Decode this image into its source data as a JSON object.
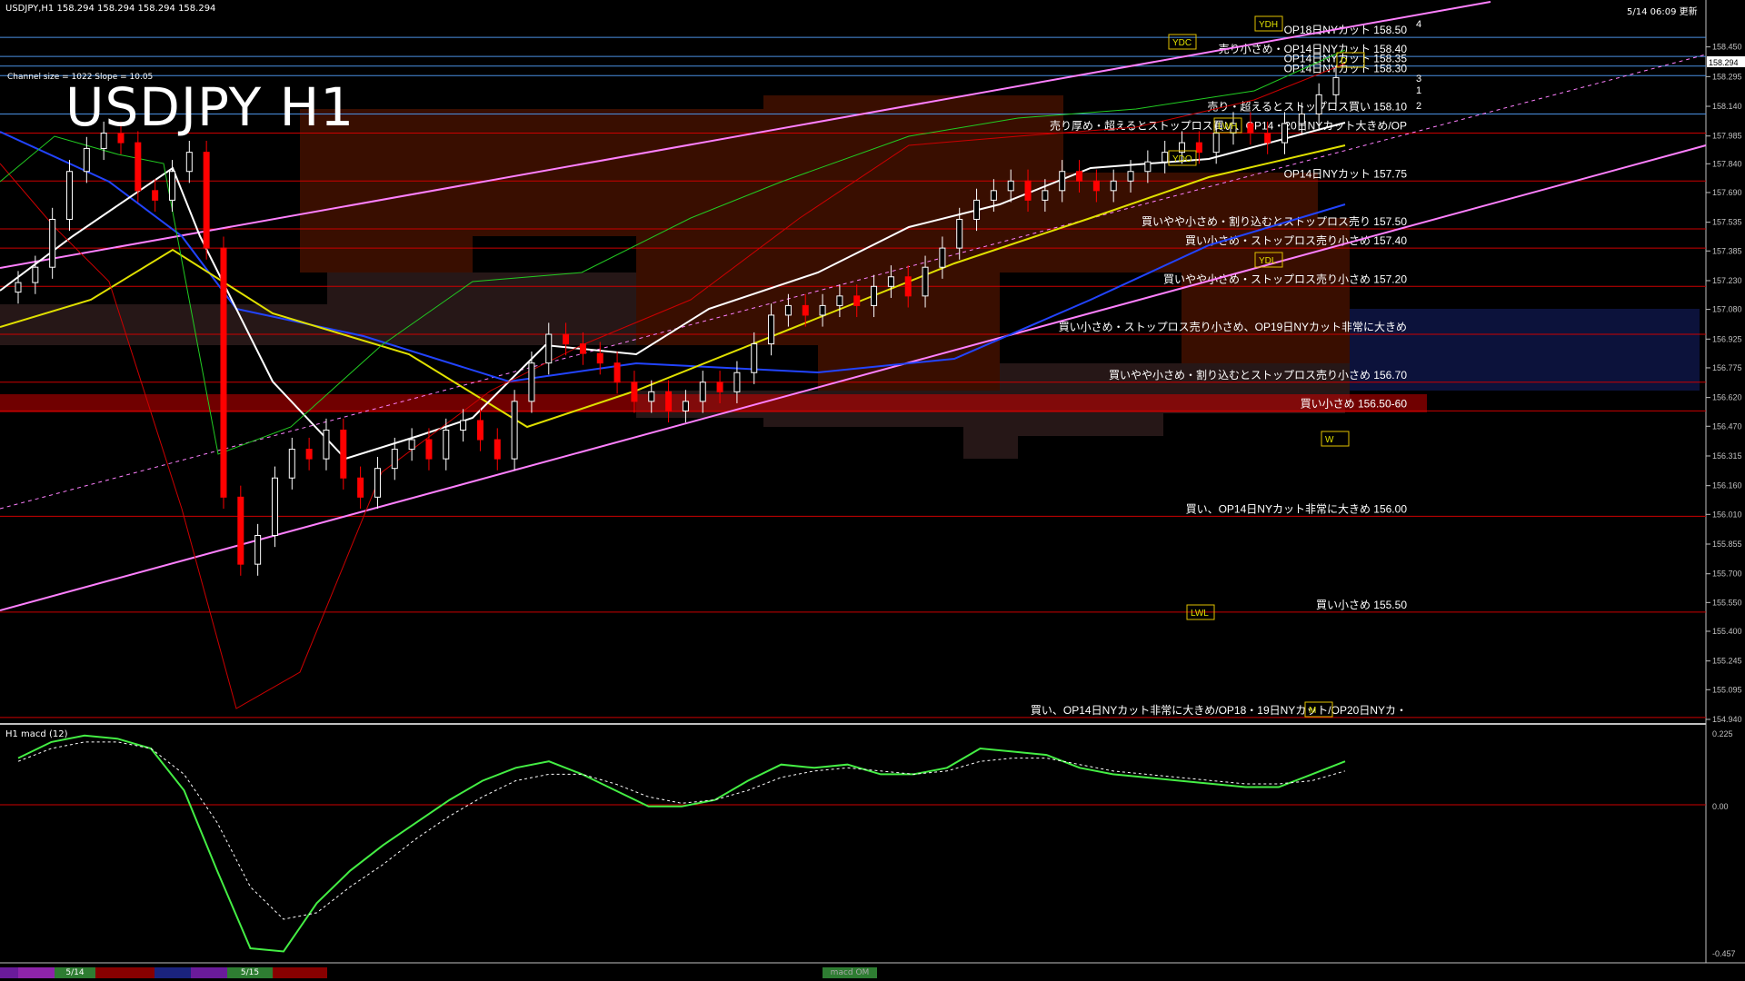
{
  "header": {
    "symbol_info": "USDJPY,H1  158.294 158.294 158.294 158.294",
    "title": "USDJPY H1",
    "channel_info": "Channel size = 1022  Slope = 10.05",
    "datetime": "5/14 06:09 更新",
    "price_box": "158.294"
  },
  "subwindow": {
    "label": "H1  macd (12)"
  },
  "tabs": [
    "",
    "5/14",
    "",
    "",
    "",
    "5/15",
    ""
  ],
  "tab_macd": "macd OM",
  "colors": {
    "background": "#000000",
    "up_candle": "#ffffff",
    "down_candle": "#ff0000",
    "channel": "#ff80ff",
    "level_line": "#cc0000",
    "blue_line": "#4a90e2",
    "macd_main": "#44ee44",
    "macd_down": "#ff88aa"
  },
  "chart_data": [
    {
      "type": "candlestick",
      "title": "USDJPY H1",
      "ylim": [
        154.94,
        158.6
      ],
      "yticks": [
        "158.450",
        "158.295",
        "158.140",
        "157.985",
        "157.840",
        "157.690",
        "157.535",
        "157.385",
        "157.230",
        "157.080",
        "156.925",
        "156.775",
        "156.620",
        "156.470",
        "156.315",
        "156.160",
        "156.010",
        "155.855",
        "155.700",
        "155.550",
        "155.400",
        "155.245",
        "155.095",
        "154.940"
      ],
      "xlabels": [
        "5/14",
        "5/15"
      ],
      "closes": [
        157.22,
        157.3,
        157.55,
        157.8,
        157.92,
        158.0,
        157.95,
        157.7,
        157.65,
        157.8,
        157.9,
        157.4,
        156.1,
        155.75,
        155.9,
        156.2,
        156.35,
        156.3,
        156.45,
        156.2,
        156.1,
        156.25,
        156.35,
        156.4,
        156.3,
        156.45,
        156.5,
        156.4,
        156.3,
        156.6,
        156.8,
        156.95,
        156.9,
        156.85,
        156.8,
        156.7,
        156.6,
        156.65,
        156.55,
        156.6,
        156.7,
        156.65,
        156.75,
        156.9,
        157.05,
        157.1,
        157.05,
        157.1,
        157.15,
        157.1,
        157.2,
        157.25,
        157.15,
        157.3,
        157.4,
        157.55,
        157.65,
        157.7,
        157.75,
        157.65,
        157.7,
        157.8,
        157.75,
        157.7,
        157.75,
        157.8,
        157.85,
        157.9,
        157.95,
        157.9,
        158.0,
        158.05,
        158.0,
        157.95,
        158.05,
        158.1,
        158.2,
        158.29
      ],
      "level_lines": [
        {
          "price": 158.5,
          "label": "OP18日NYカット 158.50"
        },
        {
          "price": 158.4,
          "label": "売り小さめ・OP14日NYカット 158.40"
        },
        {
          "price": 158.35,
          "label": "OP14日NYカット 158.35"
        },
        {
          "price": 158.3,
          "label": "OP14日NYカット 158.30"
        },
        {
          "price": 158.1,
          "label": "売り・超えるとストップロス買い 158.10"
        },
        {
          "price": 158.0,
          "label": "売り厚め・超えるとストップロス買い、OP14・20日NYカット大きめ/OP"
        },
        {
          "price": 157.75,
          "label": "OP14日NYカット 157.75"
        },
        {
          "price": 157.5,
          "label": "買いやや小さめ・割り込むとストップロス売り 157.50"
        },
        {
          "price": 157.4,
          "label": "買い小さめ・ストップロス売り小さめ 157.40"
        },
        {
          "price": 157.2,
          "label": "買いやや小さめ・ストップロス売り小さめ 157.20"
        },
        {
          "price": 156.95,
          "label": "買い小さめ・ストップロス売り小さめ、OP19日NYカット非常に大きめ"
        },
        {
          "price": 156.7,
          "label": "買いやや小さめ・割り込むとストップロス売り小さめ 156.70"
        },
        {
          "price": 156.55,
          "label": "買い小さめ 156.50-60"
        },
        {
          "price": 156.0,
          "label": "買い、OP14日NYカット非常に大きめ 156.00"
        },
        {
          "price": 155.5,
          "label": "買い小さめ 155.50"
        },
        {
          "price": 154.95,
          "label": "買い、OP14日NYカット非常に大きめ/OP18・19日NYカット/OP20日NYカ・"
        }
      ],
      "markers": [
        "YDC",
        "YDH",
        "YDO",
        "YDL",
        "LWH",
        "LWL",
        "D",
        "W",
        "M"
      ],
      "channel_numbers": [
        "4",
        "3",
        "1",
        "2"
      ]
    },
    {
      "type": "line",
      "title": "macd (12)",
      "ylim": [
        -0.457,
        0.225
      ],
      "yticks": [
        "0.225",
        "0.00",
        "-0.457"
      ],
      "series": [
        {
          "values": [
            0.15,
            0.2,
            0.22,
            0.21,
            0.18,
            0.05,
            -0.2,
            -0.44,
            -0.45,
            -0.3,
            -0.2,
            -0.12,
            -0.05,
            0.02,
            0.08,
            0.12,
            0.14,
            0.1,
            0.05,
            0.0,
            0.0,
            0.02,
            0.08,
            0.13,
            0.12,
            0.13,
            0.1,
            0.1,
            0.12,
            0.18,
            0.17,
            0.16,
            0.12,
            0.1,
            0.09,
            0.08,
            0.07,
            0.06,
            0.06,
            0.1,
            0.14
          ]
        },
        {
          "values": [
            0.14,
            0.18,
            0.2,
            0.2,
            0.18,
            0.1,
            -0.05,
            -0.25,
            -0.35,
            -0.33,
            -0.25,
            -0.18,
            -0.1,
            -0.03,
            0.03,
            0.08,
            0.1,
            0.1,
            0.07,
            0.03,
            0.01,
            0.02,
            0.05,
            0.09,
            0.11,
            0.12,
            0.11,
            0.1,
            0.11,
            0.14,
            0.15,
            0.15,
            0.13,
            0.11,
            0.1,
            0.09,
            0.08,
            0.07,
            0.07,
            0.08,
            0.11
          ]
        }
      ]
    }
  ]
}
